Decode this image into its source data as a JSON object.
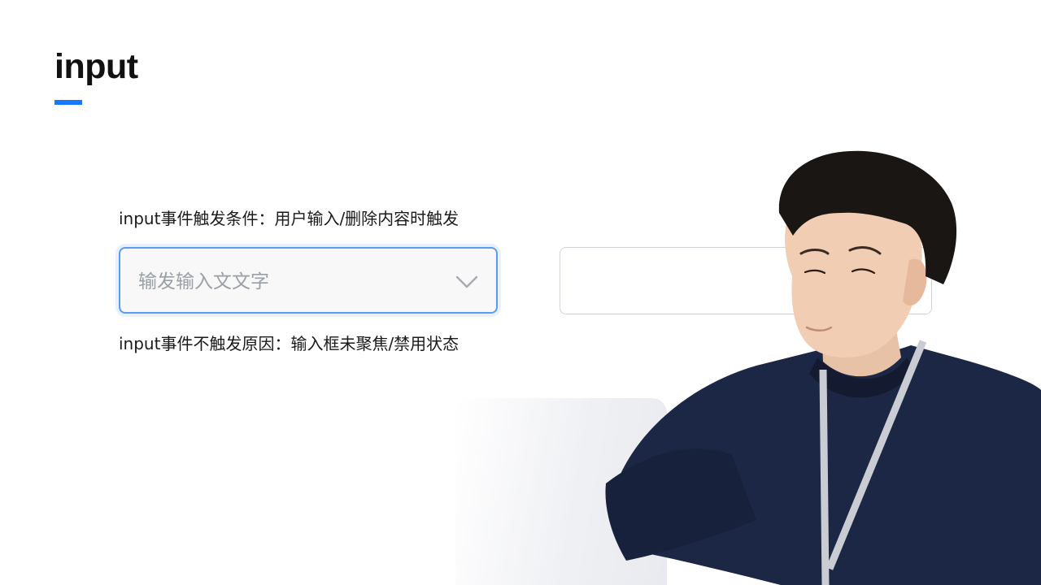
{
  "page": {
    "title": "input"
  },
  "captions": {
    "trigger": "input事件触发条件：用户输入/删除内容时触发",
    "not_trigger": "input事件不触发原因：输入框未聚焦/禁用状态"
  },
  "focused_input": {
    "value": "输发输入文文字",
    "icon": "chevron-down-icon"
  },
  "plain_input": {
    "value": ""
  },
  "photo": {
    "subject": "person-at-laptop-photo"
  },
  "colors": {
    "accent": "#1677ff",
    "focus_border": "#5b9cf0",
    "text": "#1a1a1a",
    "placeholder_text": "#9aa0a6",
    "sweater": "#1c2745"
  }
}
